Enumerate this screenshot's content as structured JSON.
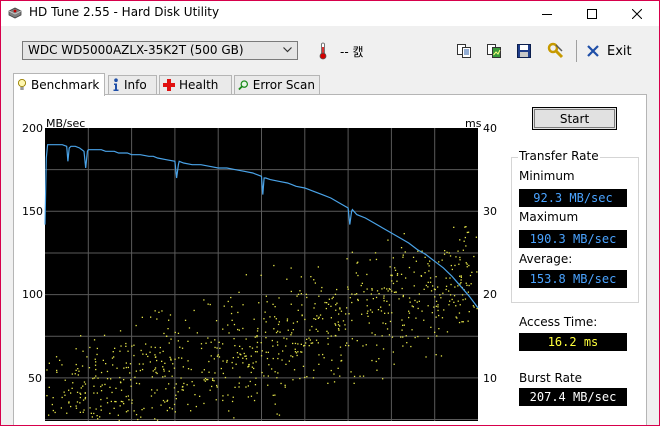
{
  "window": {
    "title": "HD Tune 2.55 - Hard Disk Utility"
  },
  "toolbar": {
    "drive": "WDC WD5000AZLX-35K2T (500 GB)",
    "temperature": "-- 캜",
    "exit_label": "Exit"
  },
  "tabs": [
    {
      "label": "Benchmark",
      "icon": "benchmark-bulb-icon",
      "active": true
    },
    {
      "label": "Info",
      "icon": "info-icon",
      "active": false
    },
    {
      "label": "Health",
      "icon": "health-cross-icon",
      "active": false
    },
    {
      "label": "Error Scan",
      "icon": "magnifier-icon",
      "active": false
    }
  ],
  "benchmark": {
    "start_label": "Start",
    "transfer_rate_title": "Transfer Rate",
    "minimum_label": "Minimum",
    "minimum_value": "92.3 MB/sec",
    "maximum_label": "Maximum",
    "maximum_value": "190.3 MB/sec",
    "average_label": "Average:",
    "average_value": "153.8 MB/sec",
    "access_time_label": "Access Time:",
    "access_time_value": "16.2 ms",
    "burst_rate_label": "Burst Rate",
    "burst_rate_value": "207.4 MB/sec"
  },
  "colors": {
    "window_border": "#d7004b",
    "transfer_line": "#4aa3e8",
    "access_dots": "#e6e64a",
    "value_blue": "#4aa3ff",
    "value_yellow": "#ffff3c",
    "value_white": "#ffffff"
  },
  "chart_data": {
    "type": "line",
    "left_axis_label": "MB/sec",
    "right_axis_label": "ms",
    "y_left_ticks": [
      "200",
      "150",
      "100",
      "50"
    ],
    "y_right_ticks": [
      "40",
      "30",
      "20",
      "10"
    ],
    "y_left_range": [
      0,
      200
    ],
    "y_right_range": [
      0,
      40
    ],
    "grid": true,
    "x_range": [
      0,
      100
    ],
    "series": [
      {
        "axis": "left",
        "x": [
          0,
          0.3,
          0.6,
          1,
          2,
          3,
          4,
          5,
          5.3,
          5.6,
          6,
          7,
          8,
          9,
          9.4,
          9.8,
          10,
          11,
          12,
          13,
          14,
          15,
          16,
          17,
          18,
          19,
          20,
          22,
          24,
          25,
          26,
          28,
          30,
          30.4,
          30.8,
          31,
          32,
          34,
          36,
          38,
          40,
          42,
          44,
          46,
          48,
          50,
          50.3,
          50.6,
          51,
          52,
          54,
          56,
          57,
          58,
          60,
          62,
          64,
          66,
          68,
          70,
          70.4,
          70.8,
          71,
          72,
          74,
          76,
          78,
          80,
          82,
          84,
          86,
          88,
          90,
          92,
          94,
          96,
          98,
          100
        ],
        "y": [
          142,
          182,
          190,
          190,
          190,
          190,
          190,
          189,
          180,
          188,
          189,
          189,
          188,
          186,
          176,
          186,
          187,
          187,
          187,
          187,
          186,
          186,
          186,
          185,
          185,
          185,
          184,
          184,
          183,
          183,
          182,
          181,
          180,
          170,
          178,
          180,
          179,
          178,
          178,
          177,
          176,
          176,
          175,
          174,
          173,
          171,
          160,
          170,
          170,
          169,
          168,
          167,
          166,
          165,
          164,
          162,
          160,
          158,
          155,
          152,
          142,
          150,
          151,
          148,
          146,
          143,
          140,
          137,
          134,
          131,
          127,
          124,
          120,
          116,
          111,
          105,
          99,
          92
        ]
      }
    ]
  }
}
